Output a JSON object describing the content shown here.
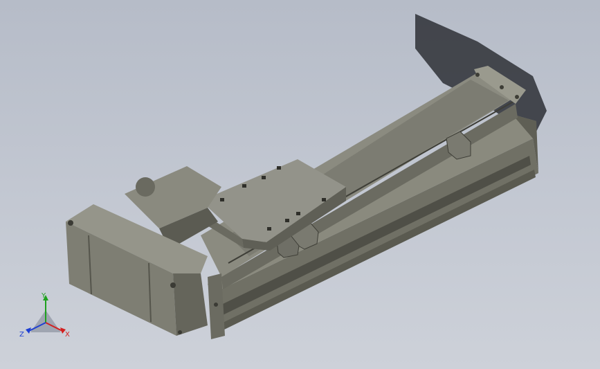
{
  "triad": {
    "x_label": "X",
    "y_label": "Y",
    "z_label": "Z"
  },
  "colors": {
    "background_top": "#b6bcc8",
    "background_bottom": "#cdd1d9",
    "body_light": "#8f8f82",
    "body_mid": "#6f6f64",
    "body_dark": "#4a4a42",
    "shadow": "#2e3036",
    "axis_x": "#d22020",
    "axis_y": "#1ea11e",
    "axis_z": "#1e3fd2"
  }
}
